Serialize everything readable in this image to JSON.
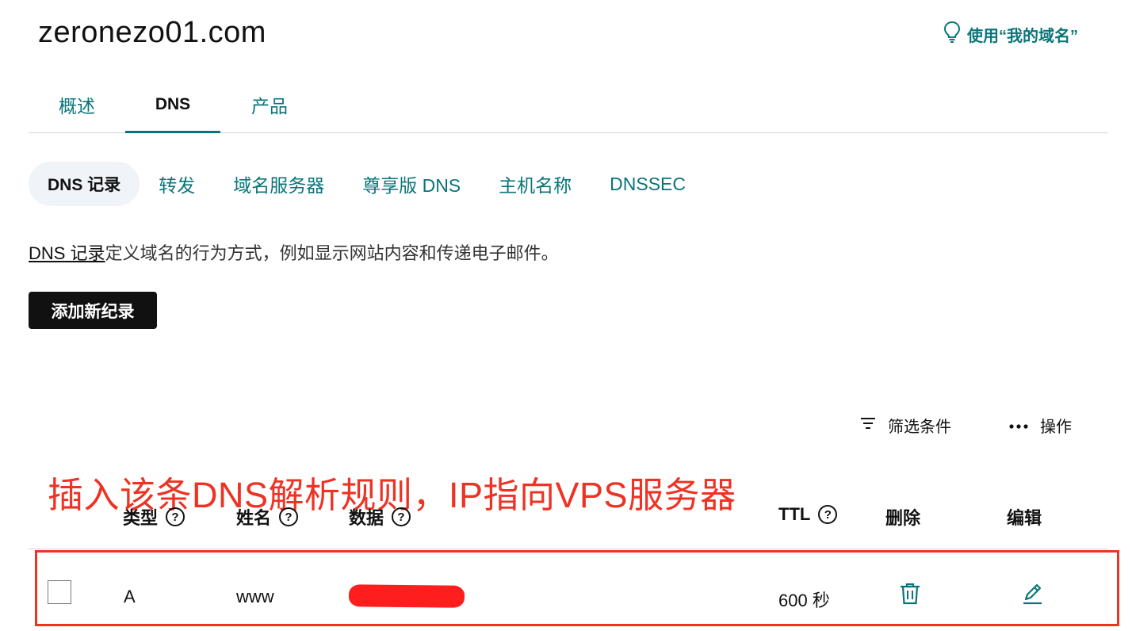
{
  "domain": "zeronezo01.com",
  "tip_link": "使用“我的域名”",
  "main_tabs": [
    {
      "label": "概述"
    },
    {
      "label": "DNS"
    },
    {
      "label": "产品"
    }
  ],
  "sub_tabs": [
    {
      "label": "DNS 记录"
    },
    {
      "label": "转发"
    },
    {
      "label": "域名服务器"
    },
    {
      "label": "尊享版 DNS"
    },
    {
      "label": "主机名称"
    },
    {
      "label": "DNSSEC"
    }
  ],
  "description": {
    "link": "DNS 记录",
    "text": "定义域名的行为方式，例如显示网站内容和传递电子邮件。"
  },
  "add_button": "添加新纪录",
  "toolbar": {
    "filter": "筛选条件",
    "actions": "操作"
  },
  "annotation": "插入该条DNS解析规则，IP指向VPS服务器",
  "table": {
    "headers": {
      "type": "类型",
      "name": "姓名",
      "data": "数据",
      "ttl": "TTL",
      "delete": "删除",
      "edit": "编辑"
    },
    "rows": [
      {
        "type": "A",
        "name": "www",
        "ttl": "600 秒"
      }
    ]
  },
  "colors": {
    "accent": "#09757a",
    "annotation": "#ee3224",
    "button": "#111111"
  }
}
